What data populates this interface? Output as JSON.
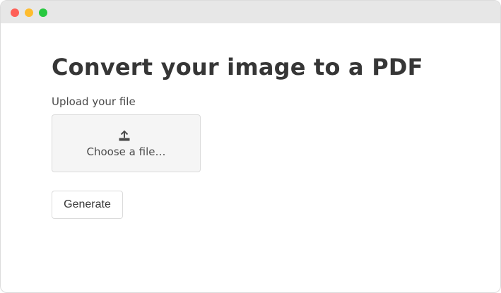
{
  "window": {
    "controls": [
      "close",
      "minimize",
      "maximize"
    ]
  },
  "main": {
    "title": "Convert your image to a PDF",
    "upload_label": "Upload your file",
    "file_input": {
      "label": "Choose a file…",
      "icon": "upload-icon"
    },
    "generate_label": "Generate"
  }
}
